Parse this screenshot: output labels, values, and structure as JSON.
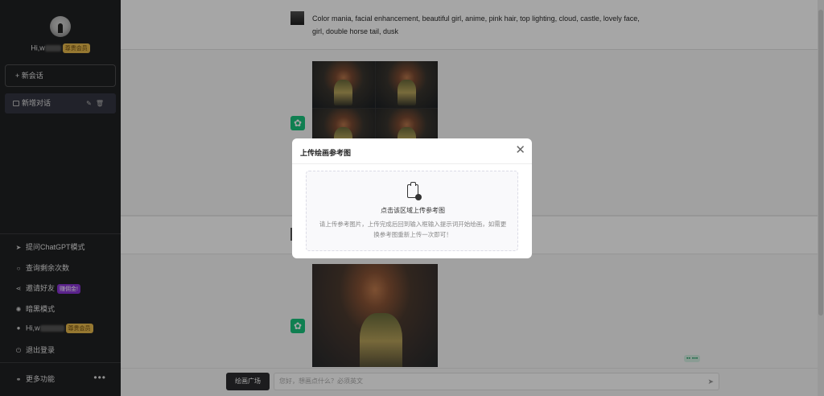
{
  "sidebar": {
    "username_prefix": "Hi,w",
    "vip_label": "尊贵会员",
    "new_chat": "+ 新会话",
    "conversation": "新增对话",
    "menu": [
      {
        "icon": "send-icon",
        "glyph": "➤",
        "label": "提问ChatGPT模式"
      },
      {
        "icon": "search-icon",
        "glyph": "○",
        "label": "查询剩余次数"
      },
      {
        "icon": "share-icon",
        "glyph": "⋖",
        "label": "邀请好友"
      },
      {
        "icon": "sun-icon",
        "glyph": "✺",
        "label": "暗黑模式"
      },
      {
        "icon": "user-icon",
        "glyph": "●",
        "label": "Hi,w"
      },
      {
        "icon": "logout-icon",
        "glyph": "⏻",
        "label": "退出登录"
      }
    ],
    "invite_badge": "赚佣金!",
    "more": "更多功能",
    "more_dots": "•••"
  },
  "chat": {
    "user_prompt": "Color mania, facial enhancement, beautiful girl, anime, pink hair, top lighting, cloud, castle, lovely face, girl, double horse tail, dusk",
    "gpt_glyph": "✿",
    "draw_button": "绘画广场",
    "input_placeholder": "您好，想画点什么？必须英文",
    "send_glyph": "➤"
  },
  "modal": {
    "title": "上传绘画参考图",
    "close_glyph": "✕",
    "upload_title": "点击该区域上传参考图",
    "upload_desc": "请上传参考图片，上传完成后回到输入框输入提示词开始绘画，如需更换参考图重新上传一次即可！"
  },
  "colors": {
    "sidebar_bg": "#202123",
    "vip_badge": "#e6b84c",
    "invite_badge": "#8b35d6",
    "gpt_green": "#19c37d"
  }
}
